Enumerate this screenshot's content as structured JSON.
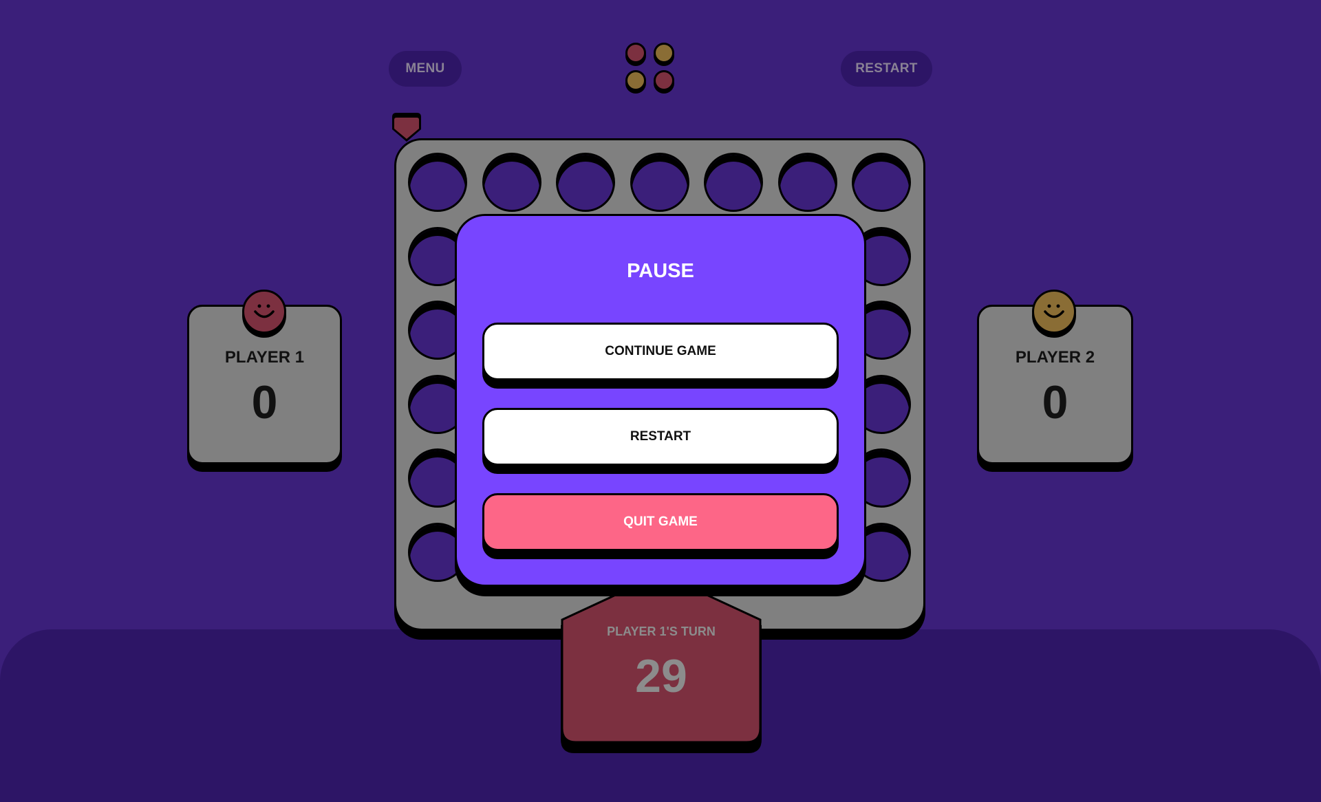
{
  "header": {
    "menu_label": "MENU",
    "restart_label": "RESTART",
    "logo_icon": "connect-four-logo-icon"
  },
  "colors": {
    "background": "#3b1f7a",
    "bottom_band": "#2d1566",
    "board": "#808080",
    "player1": "#7c3040",
    "player2": "#8a6d35",
    "modal": "#7845ff",
    "quit": "#fd6687",
    "turn_card": "#7c3040"
  },
  "board": {
    "columns": 7,
    "rows": 6
  },
  "players": [
    {
      "name": "PLAYER 1",
      "score": "0",
      "icon": "smiley-face-icon"
    },
    {
      "name": "PLAYER 2",
      "score": "0",
      "icon": "smiley-face-icon"
    }
  ],
  "pause": {
    "title": "PAUSE",
    "continue_label": "CONTINUE GAME",
    "restart_label": "RESTART",
    "quit_label": "QUIT GAME"
  },
  "turn": {
    "label": "PLAYER 1'S TURN",
    "time": "29"
  }
}
